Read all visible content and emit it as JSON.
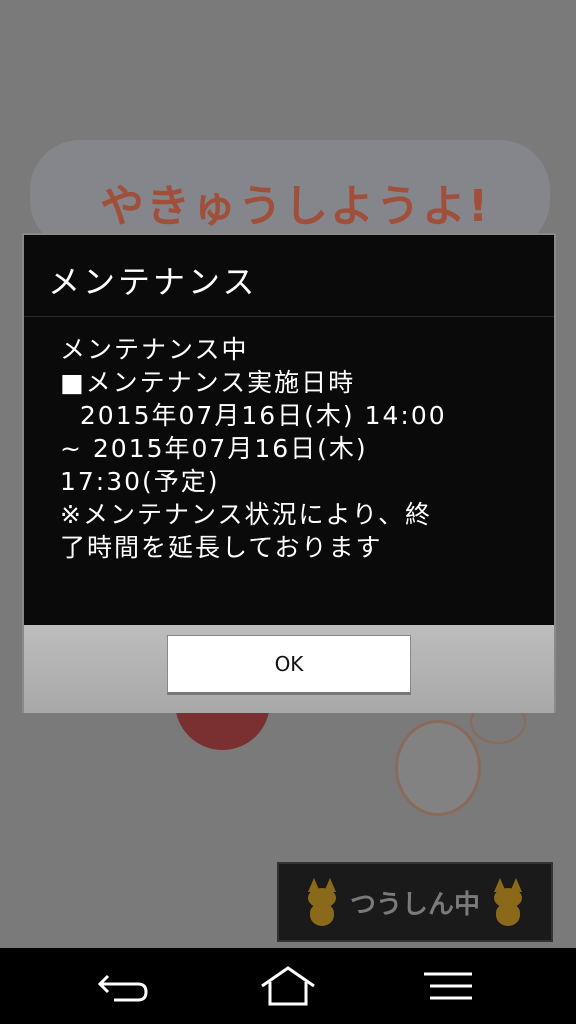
{
  "background": {
    "game_title": "やきゅうしようよ!"
  },
  "dialog": {
    "title": "メンテナンス",
    "body_lines": [
      "メンテナンス中",
      "■メンテナンス実施日時",
      "  2015年07月16日(木) 14:00",
      "~ 2015年07月16日(木)",
      "17:30(予定)",
      "※メンテナンス状況により、終",
      "了時間を延長しております"
    ],
    "ok_label": "OK"
  },
  "banner": {
    "text": "つうしん中"
  },
  "navbar": {
    "icons": [
      "back-icon",
      "home-icon",
      "menu-icon"
    ]
  },
  "colors": {
    "dialog_background": "#0a0a0a",
    "dialog_text": "#ffffff",
    "footer_gray": "#b0b0b0",
    "navbar": "#000000"
  }
}
